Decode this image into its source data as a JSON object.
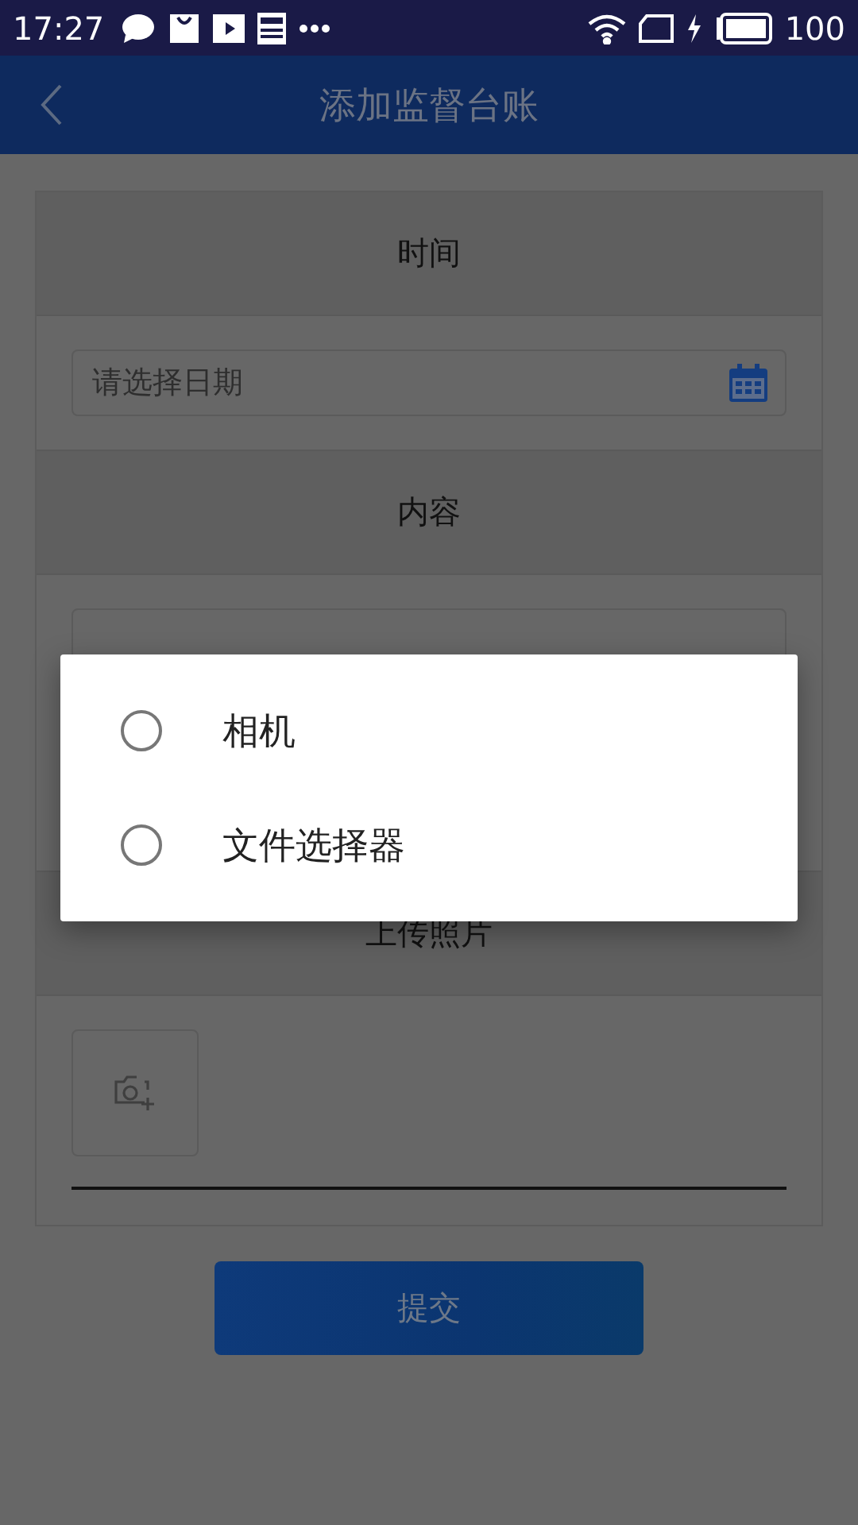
{
  "status_bar": {
    "time": "17:27",
    "battery": "100"
  },
  "header": {
    "title": "添加监督台账"
  },
  "form": {
    "sections": [
      {
        "kind": "date",
        "title": "时间",
        "placeholder": "请选择日期"
      },
      {
        "kind": "text",
        "title": "内容"
      },
      {
        "kind": "photo",
        "title": "上传照片"
      }
    ]
  },
  "submit_button": "提交",
  "dialog": {
    "options": [
      {
        "label": "相机",
        "selected": false
      },
      {
        "label": "文件选择器",
        "selected": false
      }
    ]
  }
}
